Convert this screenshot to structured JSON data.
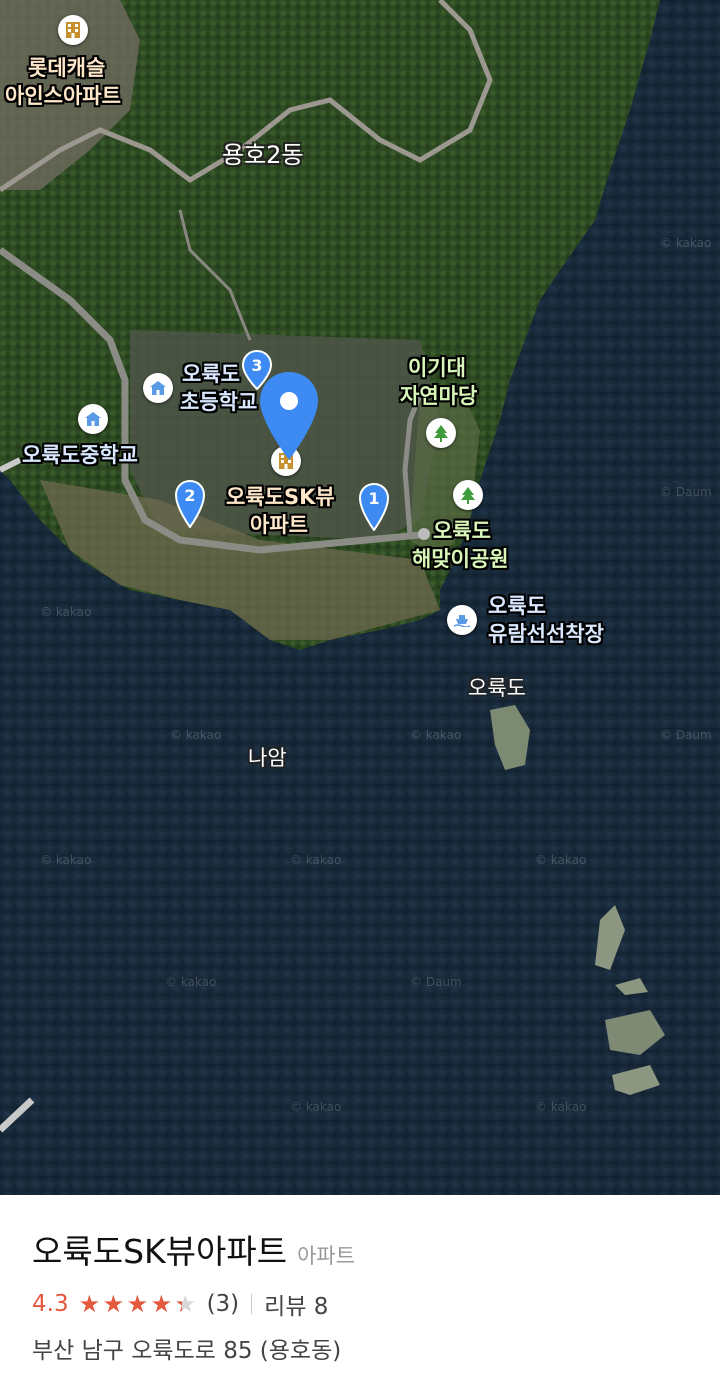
{
  "map": {
    "labels": {
      "lotte": "롯데캐슬",
      "lotte2": "아인스아파트",
      "yongho": "용호2동",
      "elem1": "오륙도",
      "elem2": "초등학교",
      "middle": "오륙도중학교",
      "igidae1": "이기대",
      "igidae2": "자연마당",
      "skview1": "오륙도SK뷰",
      "skview2": "아파트",
      "park1": "오륙도",
      "park2": "해맞이공원",
      "cruise1": "오륙도",
      "cruise2": "유람선선착장",
      "oryukdo": "오륙도",
      "naam": "나암"
    },
    "markers": {
      "m1": "1",
      "m2": "2",
      "m3": "3"
    },
    "watermark": "© kakao",
    "watermark2": "© Daum"
  },
  "place": {
    "name": "오륙도SK뷰아파트",
    "category": "아파트",
    "rating": "4.3",
    "stars": 4.3,
    "rating_count": "(3)",
    "review": "리뷰 8",
    "address": "부산 남구 오륙도로 85 (용호동)"
  },
  "colors": {
    "accent": "#e4583e",
    "pin": "#3d8bf2"
  }
}
